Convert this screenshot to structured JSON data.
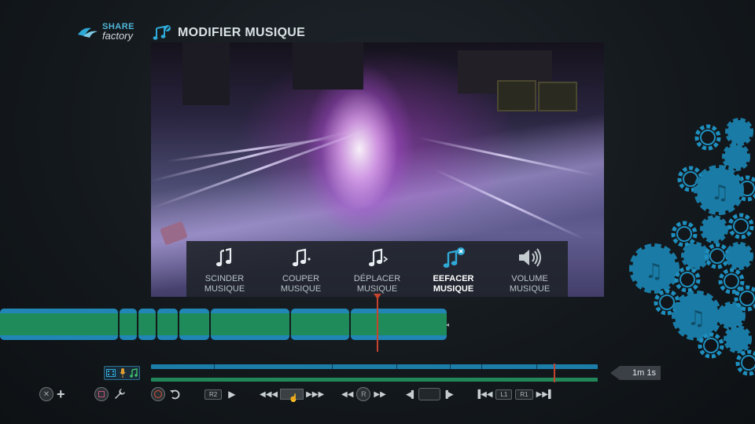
{
  "app": {
    "logo_top": "SHARE",
    "logo_bottom": "factory",
    "logo_icon": "playstation-logo-icon",
    "title": "MODIFIER MUSIQUE",
    "title_icon": "music-edit-icon"
  },
  "edit_menu": {
    "items": [
      {
        "label": "SCINDER\nMUSIQUE",
        "icon": "music-split-icon",
        "active": false
      },
      {
        "label": "COUPER\nMUSIQUE",
        "icon": "music-cut-icon",
        "active": false
      },
      {
        "label": "DÉPLACER\nMUSIQUE",
        "icon": "music-move-icon",
        "active": false
      },
      {
        "label": "EEFACER\nMUSIQUE",
        "icon": "music-delete-icon",
        "active": true
      },
      {
        "label": "VOLUME\nMUSIQUE",
        "icon": "volume-icon",
        "active": false
      }
    ]
  },
  "timeline": {
    "duration": "1m 1s",
    "track_icons": [
      "film-icon",
      "mic-icon",
      "music-icon"
    ]
  },
  "controls": {
    "r2": "R2",
    "r": "R",
    "l1": "L1",
    "r1": "R1"
  },
  "colors": {
    "accent": "#2fa9d6",
    "video_track": "#2186b6",
    "music_track": "#1f8a5a",
    "playhead": "#c6432d",
    "background": "#161b1f"
  }
}
